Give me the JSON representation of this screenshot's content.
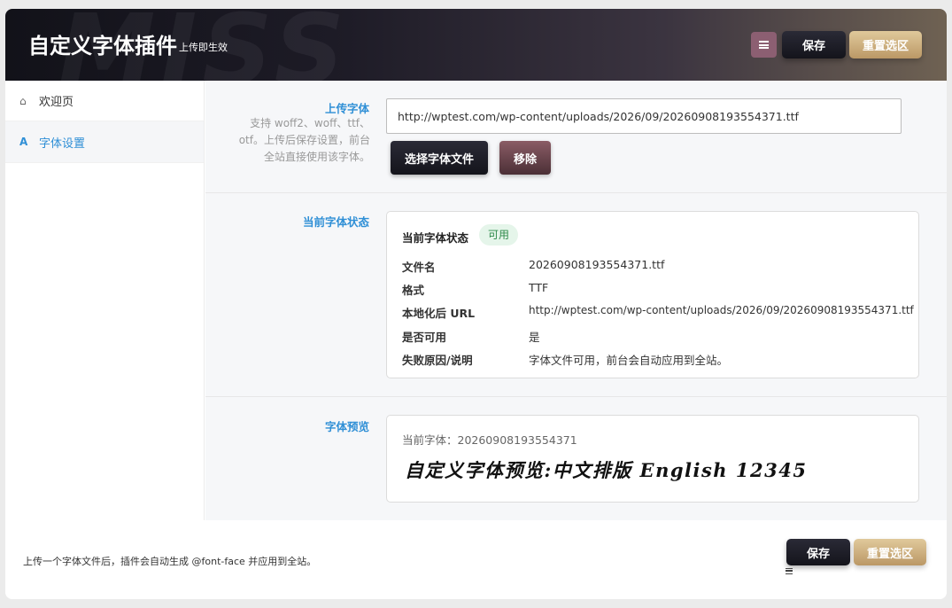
{
  "header": {
    "title": "自定义字体插件",
    "subtitle": "上传即生效",
    "watermark": "MISS",
    "menu_icon": "menu-icon",
    "save_label": "保存",
    "reset_label": "重置选区"
  },
  "sidebar": {
    "items": [
      {
        "label": "欢迎页",
        "icon": "home-icon",
        "icon_glyph": "⌂",
        "active": false
      },
      {
        "label": "字体设置",
        "icon": "font-icon",
        "icon_glyph": "A",
        "active": true
      }
    ]
  },
  "upload": {
    "label": "上传字体",
    "description": "支持 woff2、woff、ttf、otf。上传后保存设置，前台全站直接使用该字体。",
    "url_value": "http://wptest.com/wp-content/uploads/2026/09/20260908193554371.ttf",
    "choose_label": "选择字体文件",
    "remove_label": "移除"
  },
  "status": {
    "label": "当前字体状态",
    "card_title": "当前字体状态",
    "badge": "可用",
    "rows": [
      {
        "key": "文件名",
        "value": "20260908193554371.ttf"
      },
      {
        "key": "格式",
        "value": "TTF"
      },
      {
        "key": "本地化后 URL",
        "value": "http://wptest.com/wp-content/uploads/2026/09/20260908193554371.ttf"
      },
      {
        "key": "是否可用",
        "value": "是"
      },
      {
        "key": "失败原因/说明",
        "value": "字体文件可用，前台会自动应用到全站。"
      }
    ]
  },
  "preview": {
    "label": "字体预览",
    "current_font": "当前字体：20260908193554371",
    "sample_text": "自定义字体预览:中文排版 English 12345"
  },
  "footer": {
    "note": "上传一个字体文件后，插件会自动生成 @font-face 并应用到全站。",
    "save_label": "保存",
    "reset_label": "重置选区",
    "menu_icon": "menu-icon"
  },
  "colors": {
    "accent": "#2f8fd6",
    "badge_bg": "#e5f5ea",
    "badge_text": "#2e8a4a",
    "gold": "#c9a977",
    "dark": "#1b1b24"
  }
}
